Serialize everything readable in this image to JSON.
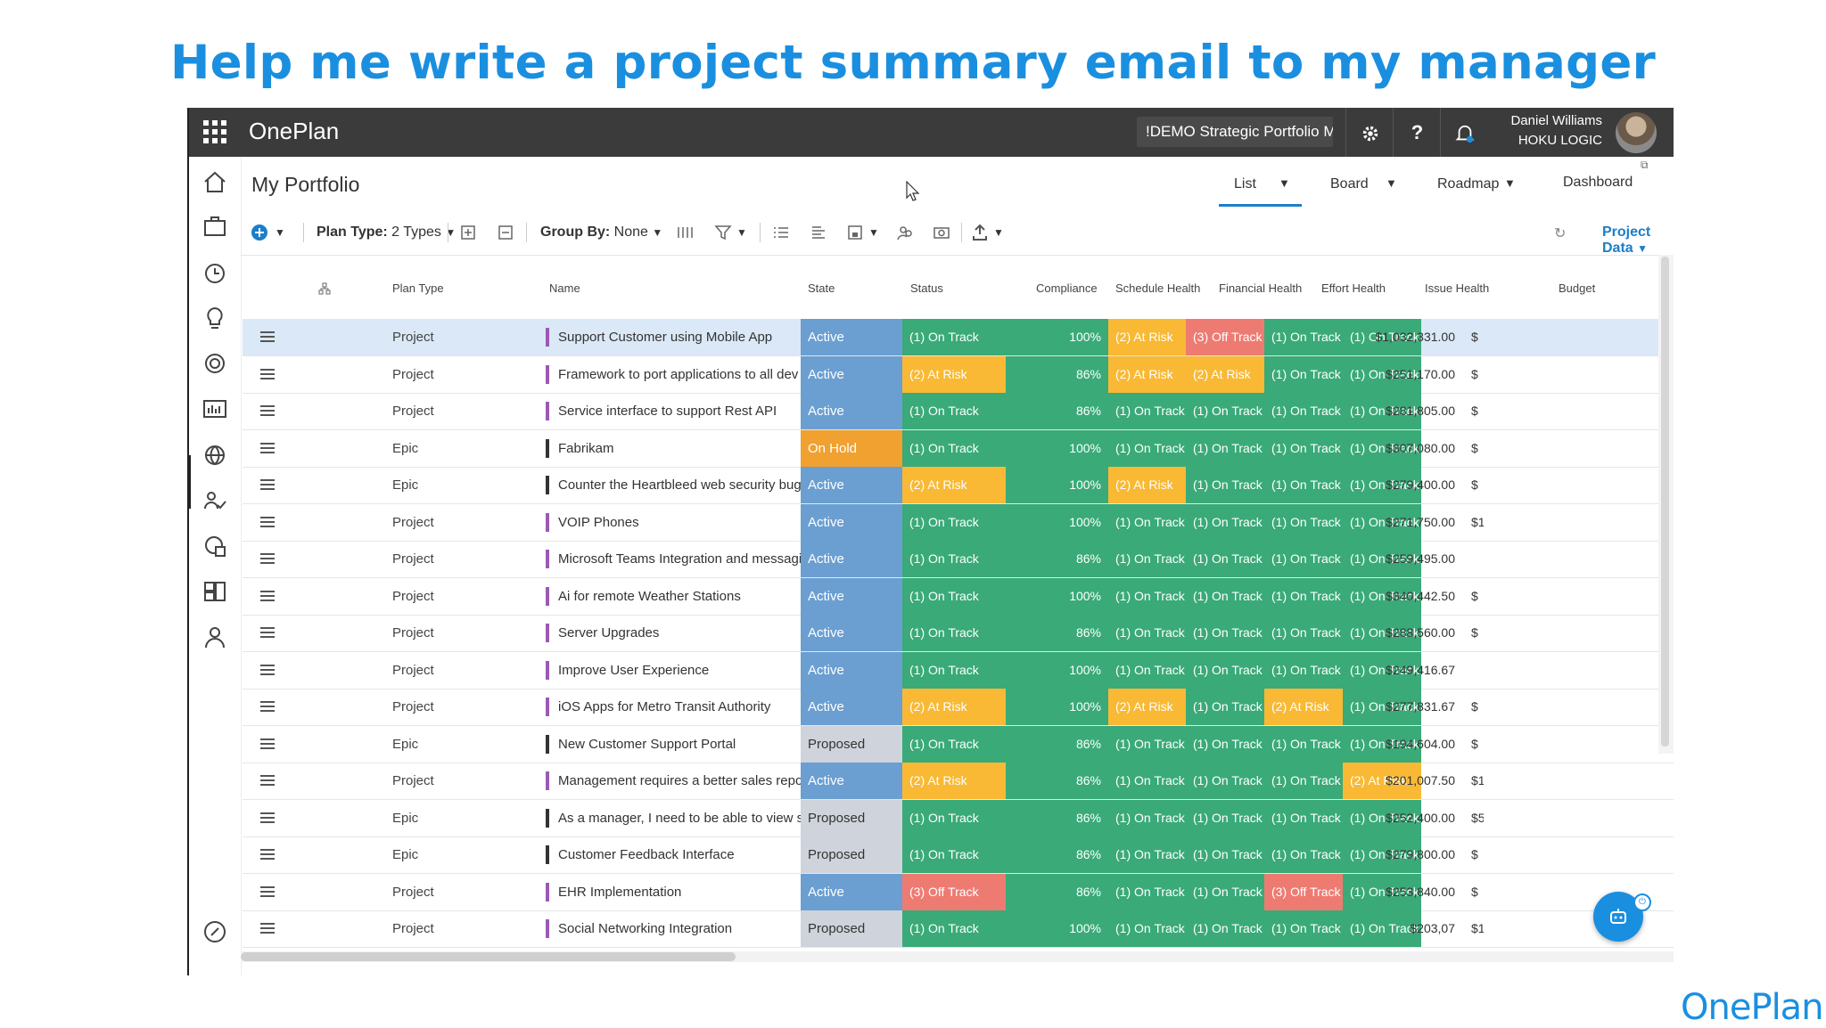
{
  "headline": "Help me write a project summary email to my manager",
  "app": {
    "brand": "OnePlan",
    "portfolio": "!DEMO Strategic Portfolio M",
    "user_name": "Daniel Williams",
    "user_org": "HOKU LOGIC"
  },
  "page_title": "My Portfolio",
  "views": [
    "List",
    "Board",
    "Roadmap",
    "Dashboard"
  ],
  "toolbar": {
    "plan_type_label": "Plan Type:",
    "plan_type_value": "2 Types",
    "group_by_label": "Group By:",
    "group_by_value": "None",
    "project_data": "Project Data"
  },
  "columns": [
    "Plan Type",
    "Name",
    "State",
    "Status",
    "Compliance",
    "Schedule Health",
    "Financial Health",
    "Effort Health",
    "Issue Health",
    "Budget"
  ],
  "colors": {
    "on_track": "#3aaa78",
    "at_risk": "#f9b934",
    "off_track": "#ee7b72",
    "active": "#6b9fd1",
    "on_hold": "#f0a130",
    "proposed": "#cfd3db"
  },
  "rows": [
    {
      "type": "Project",
      "name": "Support Customer using Mobile App",
      "state": "Active",
      "status": "(1) On Track",
      "compliance": "100%",
      "schedule": "(2) At Risk",
      "financial": "(3) Off Track",
      "effort": "(1) On Track",
      "issue": "(1) On Track",
      "budget": "$1,032,331.00",
      "trail": "$"
    },
    {
      "type": "Project",
      "name": "Framework to port applications to all dev",
      "state": "Active",
      "status": "(2) At Risk",
      "compliance": "86%",
      "schedule": "(2) At Risk",
      "financial": "(2) At Risk",
      "effort": "(1) On Track",
      "issue": "(1) On Track",
      "budget": "$251,170.00",
      "trail": "$"
    },
    {
      "type": "Project",
      "name": "Service interface to support Rest API",
      "state": "Active",
      "status": "(1) On Track",
      "compliance": "86%",
      "schedule": "(1) On Track",
      "financial": "(1) On Track",
      "effort": "(1) On Track",
      "issue": "(1) On Track",
      "budget": "$281,805.00",
      "trail": "$"
    },
    {
      "type": "Epic",
      "name": "Fabrikam",
      "state": "On Hold",
      "status": "(1) On Track",
      "compliance": "100%",
      "schedule": "(1) On Track",
      "financial": "(1) On Track",
      "effort": "(1) On Track",
      "issue": "(1) On Track",
      "budget": "$307,080.00",
      "trail": "$"
    },
    {
      "type": "Epic",
      "name": "Counter the Heartbleed web security bug",
      "state": "Active",
      "status": "(2) At Risk",
      "compliance": "100%",
      "schedule": "(2) At Risk",
      "financial": "(1) On Track",
      "effort": "(1) On Track",
      "issue": "(1) On Track",
      "budget": "$279,400.00",
      "trail": "$"
    },
    {
      "type": "Project",
      "name": "VOIP Phones",
      "state": "Active",
      "status": "(1) On Track",
      "compliance": "100%",
      "schedule": "(1) On Track",
      "financial": "(1) On Track",
      "effort": "(1) On Track",
      "issue": "(1) On Track",
      "budget": "$271,750.00",
      "trail": "$1"
    },
    {
      "type": "Project",
      "name": "Microsoft Teams Integration and messagi",
      "state": "Active",
      "status": "(1) On Track",
      "compliance": "86%",
      "schedule": "(1) On Track",
      "financial": "(1) On Track",
      "effort": "(1) On Track",
      "issue": "(1) On Track",
      "budget": "$259,495.00",
      "trail": ""
    },
    {
      "type": "Project",
      "name": "Ai for remote Weather Stations",
      "state": "Active",
      "status": "(1) On Track",
      "compliance": "100%",
      "schedule": "(1) On Track",
      "financial": "(1) On Track",
      "effort": "(1) On Track",
      "issue": "(1) On Track",
      "budget": "$340,442.50",
      "trail": "$"
    },
    {
      "type": "Project",
      "name": "Server Upgrades",
      "state": "Active",
      "status": "(1) On Track",
      "compliance": "86%",
      "schedule": "(1) On Track",
      "financial": "(1) On Track",
      "effort": "(1) On Track",
      "issue": "(1) On Track",
      "budget": "$288,560.00",
      "trail": "$"
    },
    {
      "type": "Project",
      "name": "Improve User Experience",
      "state": "Active",
      "status": "(1) On Track",
      "compliance": "100%",
      "schedule": "(1) On Track",
      "financial": "(1) On Track",
      "effort": "(1) On Track",
      "issue": "(1) On Track",
      "budget": "$249,416.67",
      "trail": ""
    },
    {
      "type": "Project",
      "name": "iOS Apps for Metro Transit Authority",
      "state": "Active",
      "status": "(2) At Risk",
      "compliance": "100%",
      "schedule": "(2) At Risk",
      "financial": "(1) On Track",
      "effort": "(2) At Risk",
      "issue": "(1) On Track",
      "budget": "$277,831.67",
      "trail": "$"
    },
    {
      "type": "Epic",
      "name": "New Customer Support Portal",
      "state": "Proposed",
      "status": "(1) On Track",
      "compliance": "86%",
      "schedule": "(1) On Track",
      "financial": "(1) On Track",
      "effort": "(1) On Track",
      "issue": "(1) On Track",
      "budget": "$194,604.00",
      "trail": "$"
    },
    {
      "type": "Project",
      "name": "Management requires a better sales repo",
      "state": "Active",
      "status": "(2) At Risk",
      "compliance": "86%",
      "schedule": "(1) On Track",
      "financial": "(1) On Track",
      "effort": "(1) On Track",
      "issue": "(2) At Risk",
      "budget": "$201,007.50",
      "trail": "$1"
    },
    {
      "type": "Epic",
      "name": "As a manager, I need to be able to view s",
      "state": "Proposed",
      "status": "(1) On Track",
      "compliance": "86%",
      "schedule": "(1) On Track",
      "financial": "(1) On Track",
      "effort": "(1) On Track",
      "issue": "(1) On Track",
      "budget": "$252,400.00",
      "trail": "$5"
    },
    {
      "type": "Epic",
      "name": "Customer Feedback Interface",
      "state": "Proposed",
      "status": "(1) On Track",
      "compliance": "86%",
      "schedule": "(1) On Track",
      "financial": "(1) On Track",
      "effort": "(1) On Track",
      "issue": "(1) On Track",
      "budget": "$279,800.00",
      "trail": "$"
    },
    {
      "type": "Project",
      "name": "EHR Implementation",
      "state": "Active",
      "status": "(3) Off Track",
      "compliance": "86%",
      "schedule": "(1) On Track",
      "financial": "(1) On Track",
      "effort": "(3) Off Track",
      "issue": "(1) On Track",
      "budget": "$253,840.00",
      "trail": "$"
    },
    {
      "type": "Project",
      "name": "Social Networking Integration",
      "state": "Proposed",
      "status": "(1) On Track",
      "compliance": "100%",
      "schedule": "(1) On Track",
      "financial": "(1) On Track",
      "effort": "(1) On Track",
      "issue": "(1) On Track",
      "budget": "$203,07",
      "trail": "$1"
    }
  ],
  "corner_logo": "OnePlan"
}
